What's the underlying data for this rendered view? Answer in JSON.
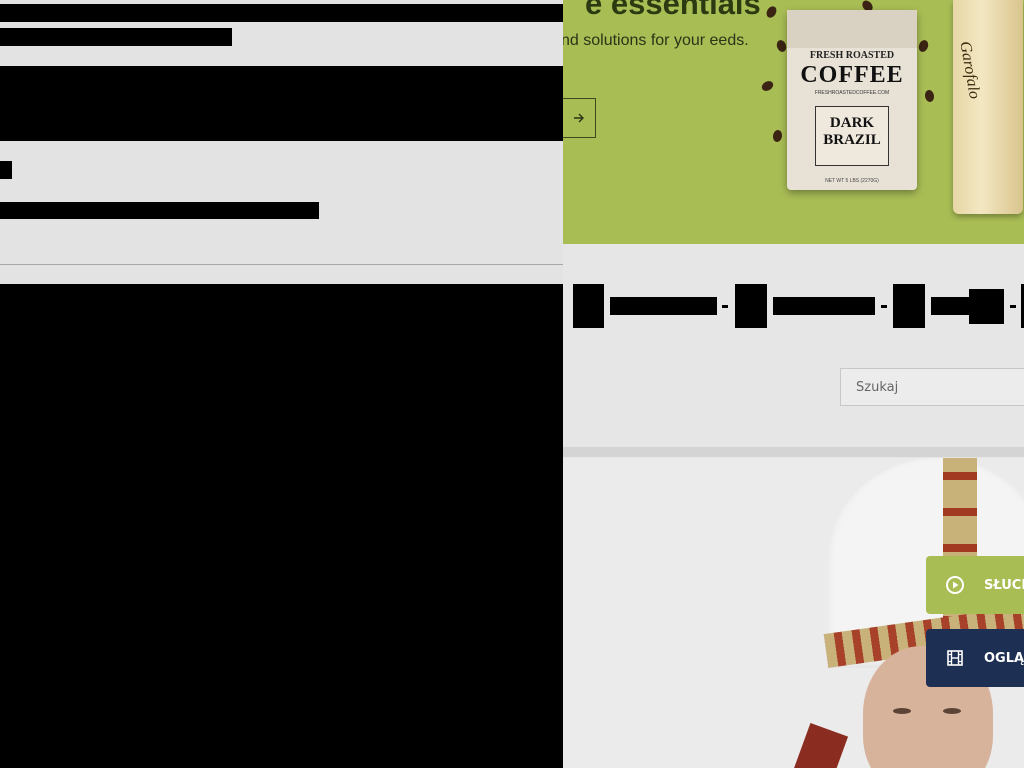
{
  "ad": {
    "headline": "e essentials",
    "subtext": "nd solutions for your eeds.",
    "cta_icon": "arrow-right-icon",
    "background": "#a9bd55",
    "coffee_bag": {
      "brand_line1": "FRESH ROASTED",
      "brand_line2": "COFFEE",
      "brand_line3": "FRESHROASTEDCOFFEE.COM",
      "label": "DARK BRAZIL",
      "footer": "NET WT 5 LBS (2270G)"
    },
    "pasta_brand": "Garofalo"
  },
  "search": {
    "placeholder": "Szukaj"
  },
  "media": {
    "listen_label": "SŁUCH",
    "listen_icon": "play-circle-icon",
    "listen_color": "#a9bd55",
    "watch_label": "OGLĄD",
    "watch_icon": "film-icon",
    "watch_color": "#1d2f52"
  },
  "overlay": {
    "background": "#e3e3e3",
    "redaction_color": "#000000"
  }
}
